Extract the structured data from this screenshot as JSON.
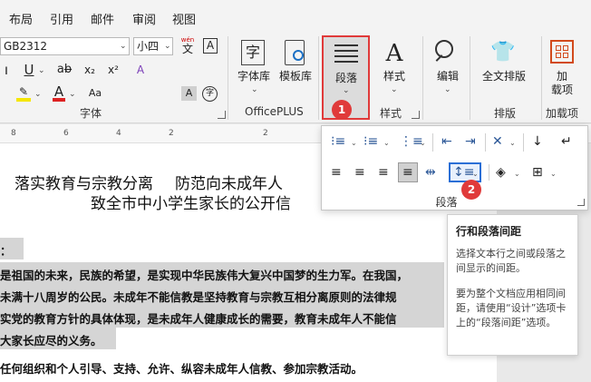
{
  "tabs": [
    "布局",
    "引用",
    "邮件",
    "审阅",
    "视图"
  ],
  "font": {
    "name": "GB2312",
    "size": "小四",
    "group_label": "字体",
    "wen": "wén",
    "wen_char": "文",
    "a_box": "A",
    "aa": "Aa",
    "circle_char": "字"
  },
  "officeplus": {
    "zitiku": "字体库",
    "mobanku": "模板库",
    "label": "OfficePLUS"
  },
  "paragraph": {
    "label": "段落",
    "popup_label": "段落"
  },
  "styles": {
    "label": "样式",
    "group_label": "样式"
  },
  "edit": {
    "label": "编辑"
  },
  "layout": {
    "label": "全文排版",
    "group_label": "排版"
  },
  "addins": {
    "label1": "加",
    "label2": "载项",
    "group_label": "加载项"
  },
  "ruler": [
    "8",
    "6",
    "4",
    "2",
    "2"
  ],
  "document": {
    "title1a": "落实教育与宗教分离",
    "title1b": "防范向未成年人",
    "title2": "致全市中小学生家长的公开信",
    "salutation": "：",
    "lines": [
      "是祖国的未来，民族的希望，是实现中华民族伟大复兴中国梦的生力军。在我国，",
      "未满十八周岁的公民。未成年不能信教是坚持教育与宗教互相分离原则的法律规",
      "实党的教育方针的具体体现，是未成年人健康成长的需要，教育未成年人不能信",
      "大家长应尽的义务。",
      "任何组织和个人引导、支持、允许、纵容未成年人信教、参加宗教活动。"
    ]
  },
  "tooltip": {
    "title": "行和段落间距",
    "p1": "选择文本行之间或段落之间显示的间距。",
    "p2": "要为整个文档应用相同间距，请使用“设计”选项卡上的“段落间距”选项。"
  },
  "badges": {
    "one": "1",
    "two": "2"
  }
}
